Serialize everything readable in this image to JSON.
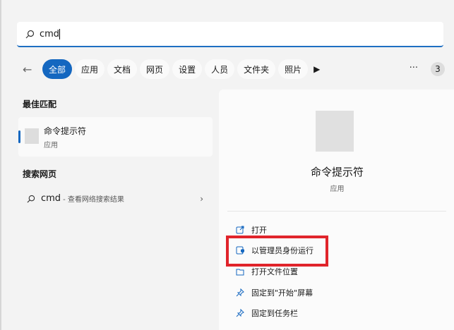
{
  "search": {
    "value": "cmd"
  },
  "filters": {
    "back": "←",
    "items": [
      "全部",
      "应用",
      "文档",
      "网页",
      "设置",
      "人员",
      "文件夹",
      "照片"
    ],
    "more": "···",
    "count": "3"
  },
  "best_match": {
    "heading": "最佳匹配",
    "title": "命令提示符",
    "subtitle": "应用"
  },
  "web_search": {
    "heading": "搜索网页",
    "query": "cmd",
    "desc": "- 查看网络搜索结果"
  },
  "detail": {
    "title": "命令提示符",
    "subtitle": "应用",
    "actions": [
      {
        "label": "打开",
        "icon": "open-icon"
      },
      {
        "label": "以管理员身份运行",
        "icon": "admin-shield-icon"
      },
      {
        "label": "打开文件位置",
        "icon": "folder-icon"
      },
      {
        "label": "固定到\"开始\"屏幕",
        "icon": "pin-icon"
      },
      {
        "label": "固定到任务栏",
        "icon": "pin-icon"
      }
    ]
  },
  "colors": {
    "accent": "#1467c0",
    "highlight": "#e0242b"
  }
}
